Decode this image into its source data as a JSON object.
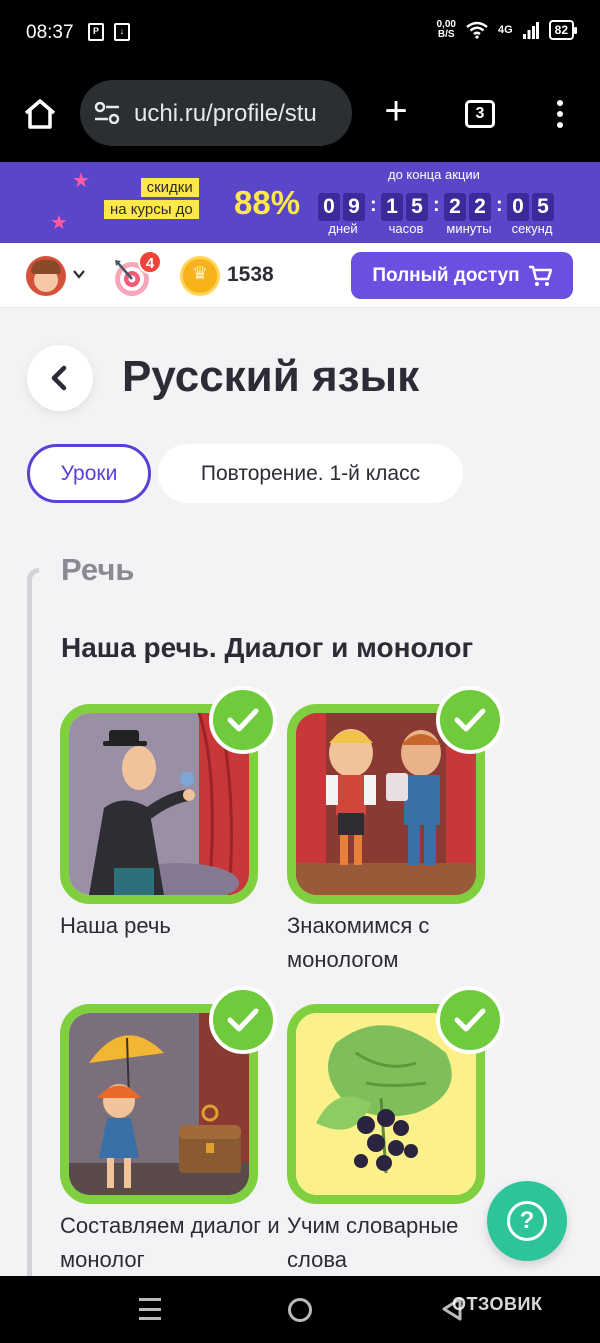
{
  "status_bar": {
    "time": "08:37",
    "net_speed_value": "0,00",
    "net_speed_unit": "B/S",
    "network": "4G",
    "battery": "82"
  },
  "browser": {
    "url": "uchi.ru/profile/stu",
    "tab_count": "3"
  },
  "promo": {
    "discount_line1": "скидки",
    "discount_line2": "на курсы до",
    "percent": "88%",
    "until_label": "до конца акции",
    "timer": {
      "days": [
        "0",
        "9"
      ],
      "hours": [
        "1",
        "5"
      ],
      "minutes": [
        "2",
        "2"
      ],
      "seconds": [
        "0",
        "5"
      ],
      "labels": [
        "дней",
        "часов",
        "минуты",
        "секунд"
      ]
    },
    "accent_color": "#ffe84a",
    "bg_color": "#5a46c8"
  },
  "header": {
    "target_badge": "4",
    "coins": "1538",
    "full_access_label": "Полный доступ"
  },
  "page": {
    "title": "Русский язык",
    "tabs": [
      {
        "label": "Уроки",
        "active": true
      },
      {
        "label": "Повторение. 1-й класс",
        "active": false
      }
    ],
    "section": "Речь",
    "topic": "Наша речь. Диалог и монолог",
    "lessons": [
      {
        "title": "Наша речь",
        "completed": true,
        "image": "mime-on-stage"
      },
      {
        "title": "Знакомимся с монологом",
        "completed": true,
        "image": "two-boys-on-stage"
      },
      {
        "title": "Составляем диалог и монолог",
        "completed": true,
        "image": "girl-with-umbrella"
      },
      {
        "title": "Учим словарные слова",
        "completed": true,
        "image": "blackcurrant"
      }
    ]
  },
  "watermark": "ОТЗОВИК",
  "colors": {
    "primary": "#6a4fe0",
    "check_green": "#6fcb3c",
    "help": "#2ec49a"
  }
}
